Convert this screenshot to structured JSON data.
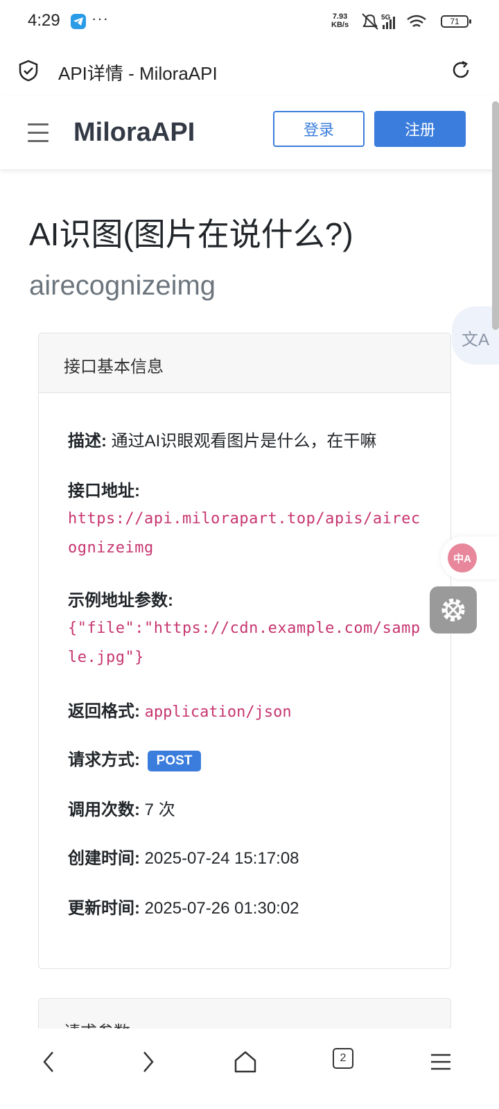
{
  "status_bar": {
    "time": "4:29",
    "more": "···",
    "net_speed_value": "7.93",
    "net_speed_unit": "KB/s",
    "network": "5G",
    "battery": "71"
  },
  "browser": {
    "tab_title": "API详情 - MiloraAPI",
    "tab_count": "2"
  },
  "nav": {
    "brand": "MiloraAPI",
    "login": "登录",
    "register": "注册"
  },
  "api": {
    "title": "AI识图(图片在说什么?)",
    "name": "airecognizeimg"
  },
  "card": {
    "header": "接口基本信息",
    "desc_label": "描述:",
    "desc_value": "通过AI识眼观看图片是什么，在干嘛",
    "url_label": "接口地址:",
    "url_value": "https://api.milorapart.top/apis/airecognizeimg",
    "example_label": "示例地址参数:",
    "example_value": "{\"file\":\"https://cdn.example.com/sample.jpg\"}",
    "format_label": "返回格式:",
    "format_value": "application/json",
    "method_label": "请求方式:",
    "method_value": "POST",
    "calls_label": "调用次数:",
    "calls_value": "7 次",
    "created_label": "创建时间:",
    "created_value": "2025-07-24 15:17:08",
    "updated_label": "更新时间:",
    "updated_value": "2025-07-26 01:30:02"
  },
  "card2": {
    "header": "请求参数"
  },
  "floating": {
    "translate_glyph": "文A",
    "voice_glyph": "中A"
  }
}
